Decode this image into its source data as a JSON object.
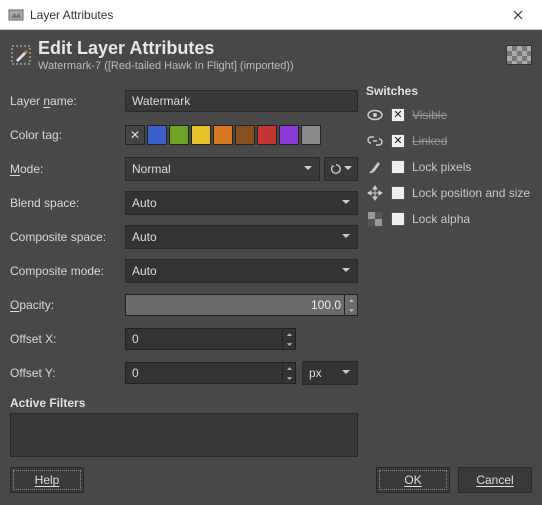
{
  "window": {
    "title": "Layer Attributes"
  },
  "header": {
    "title": "Edit Layer Attributes",
    "subtitle": "Watermark-7 ([Red-tailed Hawk In Flight] (imported))"
  },
  "labels": {
    "layer_name": "Layer name:",
    "color_tag": "Color tag:",
    "mode": "Mode:",
    "blend_space": "Blend space:",
    "composite_space": "Composite space:",
    "composite_mode": "Composite mode:",
    "opacity": "Opacity:",
    "offset_x": "Offset X:",
    "offset_y": "Offset Y:",
    "active_filters": "Active Filters",
    "switches": "Switches"
  },
  "values": {
    "layer_name": "Watermark",
    "mode": "Normal",
    "blend_space": "Auto",
    "composite_space": "Auto",
    "composite_mode": "Auto",
    "opacity": "100.0",
    "offset_x": "0",
    "offset_y": "0",
    "unit": "px"
  },
  "color_tags": [
    {
      "name": "none",
      "hex": "#444444"
    },
    {
      "name": "blue",
      "hex": "#3a5ecc"
    },
    {
      "name": "green",
      "hex": "#6aa325"
    },
    {
      "name": "yellow",
      "hex": "#e5c22a"
    },
    {
      "name": "orange",
      "hex": "#d6791e"
    },
    {
      "name": "brown",
      "hex": "#8a4f1e"
    },
    {
      "name": "red",
      "hex": "#c63333"
    },
    {
      "name": "violet",
      "hex": "#8a3ad6"
    },
    {
      "name": "gray",
      "hex": "#888888"
    }
  ],
  "switches": {
    "visible": {
      "label": "Visible",
      "checked": true,
      "struck": true
    },
    "linked": {
      "label": "Linked",
      "checked": true,
      "struck": true
    },
    "lock_pixels": {
      "label": "Lock pixels",
      "checked": false
    },
    "lock_position": {
      "label": "Lock position and size",
      "checked": false
    },
    "lock_alpha": {
      "label": "Lock alpha",
      "checked": false
    }
  },
  "buttons": {
    "help": "Help",
    "ok": "OK",
    "cancel": "Cancel"
  }
}
